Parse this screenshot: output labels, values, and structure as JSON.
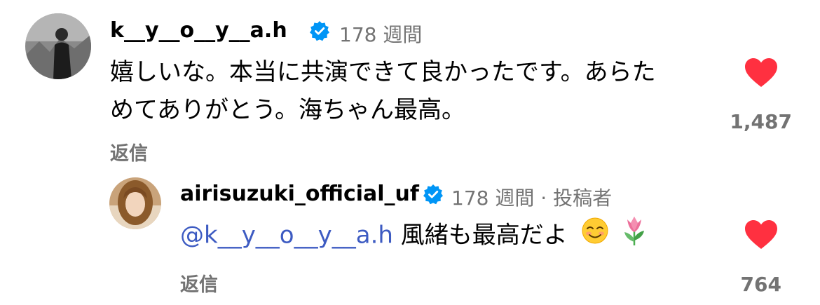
{
  "comment": {
    "username": "k__y__o__y__a.h",
    "time": "178 週間",
    "text_line1": "嬉しいな。本当に共演できて良かったです。あらた",
    "text_line2": "めてありがとう。海ちゃん最高。",
    "reply_label": "返信",
    "like_count": "1,487",
    "heart_color": "#ff3040",
    "verified_color": "#0095f6"
  },
  "reply": {
    "username": "airisuzuki_official_uf",
    "time": "178 週間",
    "separator": "·",
    "author_badge": "投稿者",
    "mention": "@k__y__o__y__a.h",
    "text": "風緒も最高だよ",
    "emojis": [
      "smiling-face-icon",
      "tulip-icon"
    ],
    "reply_label": "返信",
    "like_count": "764"
  }
}
